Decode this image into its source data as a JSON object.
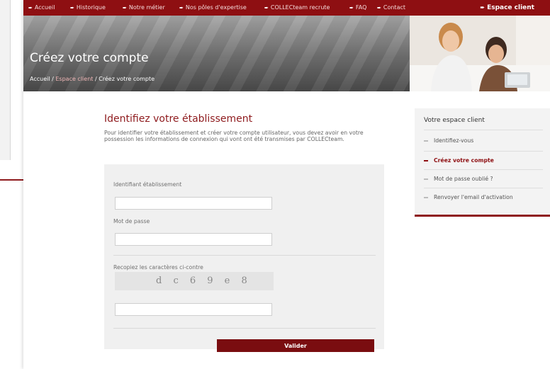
{
  "nav": {
    "items": [
      "Accueil",
      "Historique",
      "Notre métier",
      "Nos pôles d'expertise",
      "COLLECteam recrute",
      "FAQ",
      "Contact"
    ],
    "client_label": "Espace client"
  },
  "banner": {
    "title": "Créez votre compte",
    "breadcrumb": [
      "Accueil",
      "Espace client",
      "Créez votre compte"
    ],
    "separator": " / "
  },
  "main": {
    "title": "Identifiez votre établissement",
    "intro": "Pour identifier votre établissement et créer votre compte utilisateur, vous devez avoir en votre possession les informations de connexion qui vont ont été transmises par COLLECteam."
  },
  "form": {
    "id_label": "Identifiant établissement",
    "id_value": "",
    "password_label": "Mot de passe",
    "password_value": "",
    "captcha_label": "Recopiez les caractères ci-contre",
    "captcha_text": "d c 6 9 e 8",
    "captcha_value": "",
    "submit_label": "Valider"
  },
  "sidebar": {
    "title": "Votre espace client",
    "items": [
      {
        "label": "Identifiez-vous",
        "active": false
      },
      {
        "label": "Créez votre compte",
        "active": true
      },
      {
        "label": "Mot de passe oublié ?",
        "active": false
      },
      {
        "label": "Renvoyer l'email d'activation",
        "active": false
      }
    ]
  },
  "colors": {
    "brand": "#8e0f12",
    "accent": "#8e1a1d"
  }
}
